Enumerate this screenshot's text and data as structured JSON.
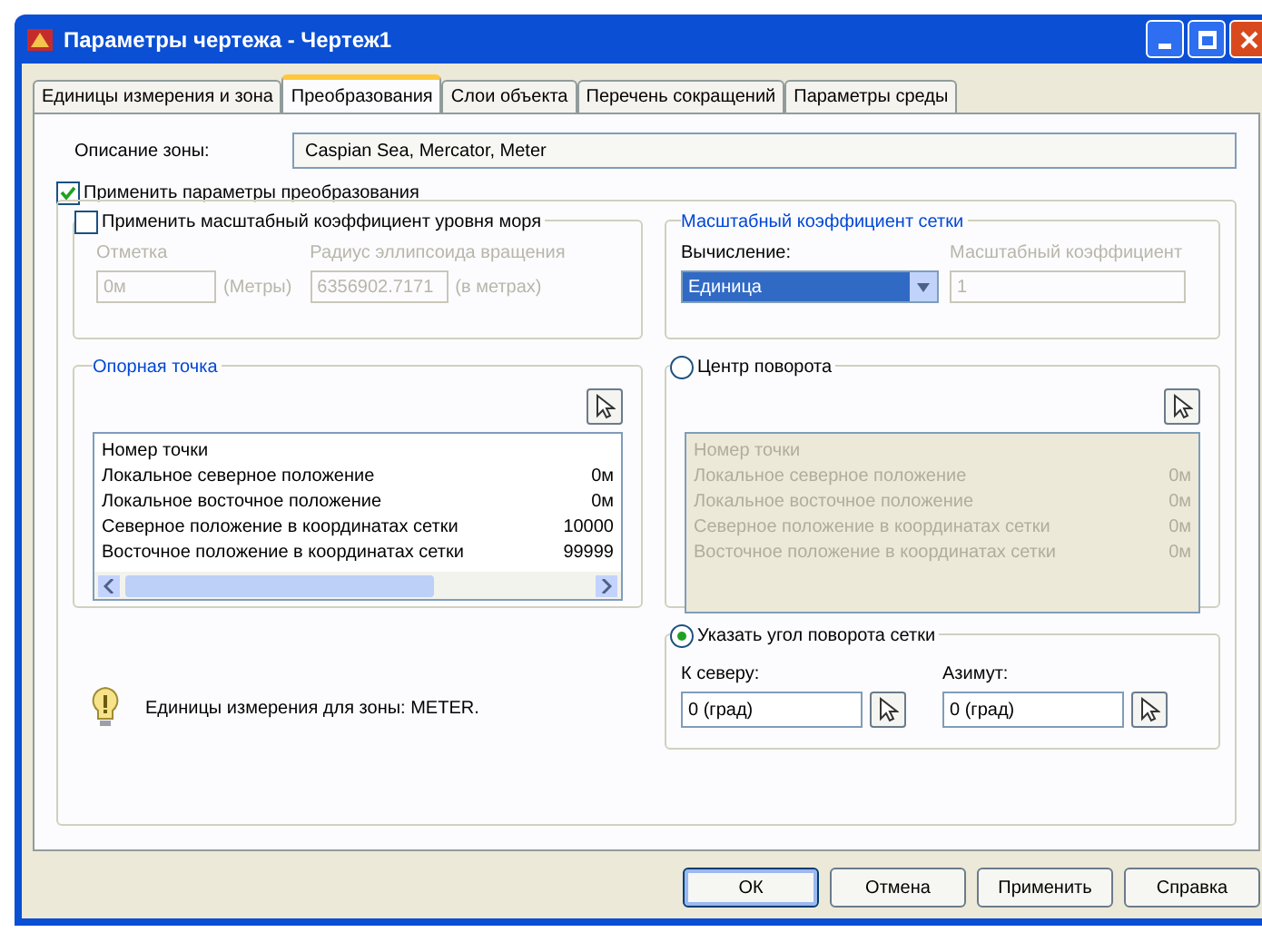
{
  "window": {
    "title": "Параметры чертежа - Чертеж1"
  },
  "tabs": [
    {
      "label": "Единицы измерения и зона",
      "selected": false
    },
    {
      "label": "Преобразования",
      "selected": true
    },
    {
      "label": "Слои объекта",
      "selected": false
    },
    {
      "label": "Перечень сокращений",
      "selected": false
    },
    {
      "label": "Параметры среды",
      "selected": false
    }
  ],
  "zone_description": {
    "label": "Описание зоны:",
    "value": "Caspian Sea, Mercator, Meter"
  },
  "apply_transform": {
    "label": "Применить параметры преобразования",
    "checked": true
  },
  "sea_level_scale": {
    "label": "Применить масштабный коэффициент уровня моря",
    "checked": false,
    "elevation_label": "Отметка",
    "elevation_value": "0м",
    "elevation_unit": "(Метры)",
    "radius_label": "Радиус эллипсоида вращения",
    "radius_value": "6356902.7171",
    "radius_unit": "(в метрах)"
  },
  "grid_scale": {
    "title": "Масштабный коэффициент сетки",
    "calc_label": "Вычисление:",
    "calc_value": "Единица",
    "factor_label": "Масштабный коэффициент",
    "factor_value": "1"
  },
  "reference_point": {
    "title": "Опорная точка",
    "rows": [
      {
        "name": "Номер точки",
        "value": ""
      },
      {
        "name": "Локальное северное положение",
        "value": "0м"
      },
      {
        "name": "Локальное восточное положение",
        "value": "0м"
      },
      {
        "name": "Северное положение в координатах сетки",
        "value": "10000"
      },
      {
        "name": "Восточное положение в координатах сетки",
        "value": "99999"
      }
    ]
  },
  "rotation_center": {
    "label": "Центр поворота",
    "selected": false,
    "rows": [
      {
        "name": "Номер точки",
        "value": ""
      },
      {
        "name": "Локальное северное положение",
        "value": "0м"
      },
      {
        "name": "Локальное восточное положение",
        "value": "0м"
      },
      {
        "name": "Северное положение в координатах сетки",
        "value": "0м"
      },
      {
        "name": "Восточное положение в координатах сетки",
        "value": "0м"
      }
    ]
  },
  "info_text": "Единицы измерения для зоны: METER.",
  "grid_rotation": {
    "label": "Указать угол поворота сетки",
    "selected": true,
    "north_label": "К северу:",
    "north_value": "0 (град)",
    "azimuth_label": "Азимут:",
    "azimuth_value": "0 (град)"
  },
  "buttons": [
    {
      "label": "ОК",
      "default": true
    },
    {
      "label": "Отмена",
      "default": false
    },
    {
      "label": "Применить",
      "default": false
    },
    {
      "label": "Справка",
      "default": false
    }
  ]
}
